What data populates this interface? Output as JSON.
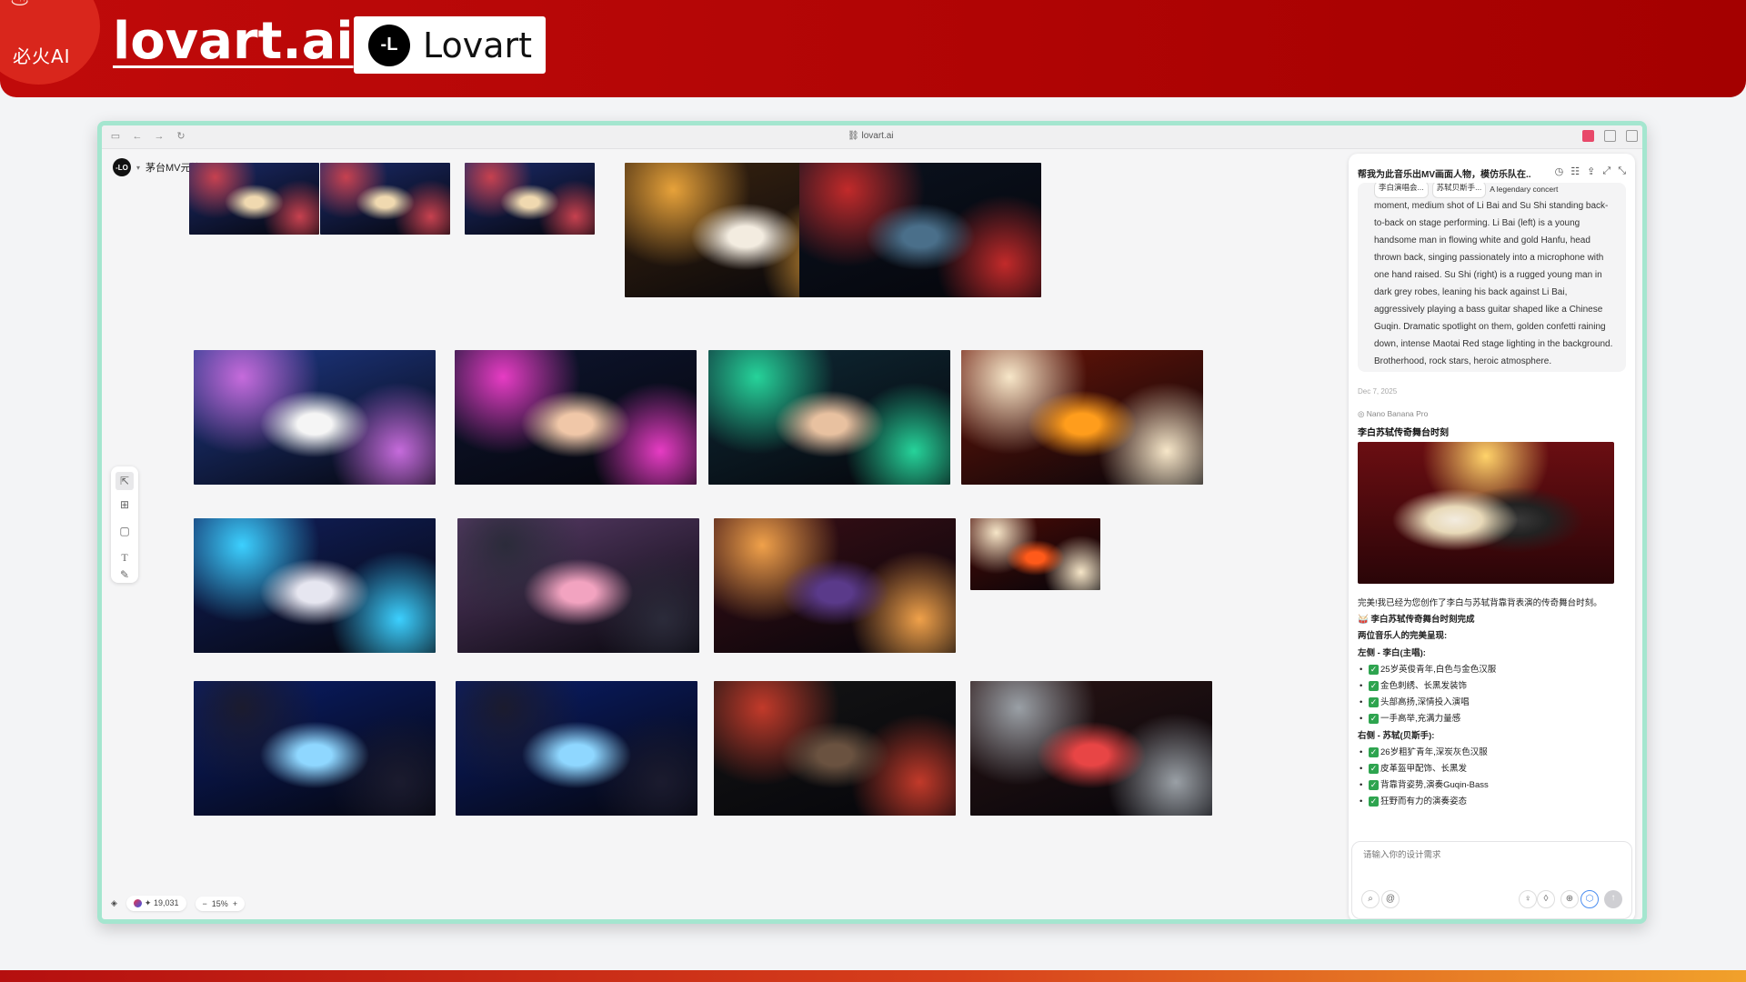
{
  "banner": {
    "brand_glyph": "♨",
    "brand_label": "必火AI",
    "site_title": "lovart.ai",
    "lovart_logo_text": "-L",
    "lovart_word": "Lovart"
  },
  "browser": {
    "url": "lovart.ai",
    "icons": [
      "sidebar-icon",
      "back-icon",
      "forward-icon",
      "reload-icon",
      "link-icon"
    ]
  },
  "project": {
    "logo_text": "-LO",
    "name": "茅台MV元峰"
  },
  "canvas": {
    "tools": [
      "select-icon",
      "add-frame-icon",
      "rectangle-icon",
      "text-icon",
      "pen-icon"
    ],
    "status": {
      "credits": "✦ 19,031",
      "zoom": "15%",
      "zoom_minus": "−",
      "zoom_plus": "+"
    },
    "image_themes": [
      "ensemble",
      "ensemble",
      "ensemble",
      "guqin-singer",
      "stadium",
      "spotlight-singer",
      "rock-closeup",
      "hand-gesture",
      "fire-stage",
      "blue-stage-band",
      "drummer",
      "pipa-player",
      "red-fire-stage",
      "lightning-guitar",
      "lightning-guitar",
      "dark-guitarist",
      "windblown-guitarist"
    ]
  },
  "chat": {
    "title": "帮我为此音乐出MV画面人物，模仿乐队在...",
    "header_icons": [
      "history-icon",
      "settings-icon",
      "share-icon",
      "collapse-icon",
      "minimize-icon"
    ],
    "prompt_tags": [
      "李白演唱会...",
      "苏轼贝斯手..."
    ],
    "prompt_text_lead": "A legendary concert",
    "prompt_text": "moment, medium shot of Li Bai and Su Shi standing back-to-back on stage performing. Li Bai (left) is a young handsome man in flowing white and gold Hanfu, head thrown back, singing passionately into a microphone with one hand raised. Su Shi (right) is a rugged young man in dark grey robes, leaning his back against Li Bai, aggressively playing a bass guitar shaped like a Chinese Guqin. Dramatic spotlight on them, golden confetti raining down, intense Maotai Red stage lighting in the background. Brotherhood, rock stars, heroic atmosphere.",
    "date": "Dec 7, 2025",
    "model": "Nano Banana Pro",
    "result_title": "李白苏轼传奇舞台时刻",
    "summary_intro": "完美!我已经为您创作了李白与苏轼背靠背表演的传奇舞台时刻。",
    "summary_done": "🥁 李白苏轼传奇舞台时刻完成",
    "summary_sub": "两位音乐人的完美呈现:",
    "left_label": "左侧 - 李白(主唱):",
    "left_items": [
      "25岁英俊青年,白色与金色汉服",
      "金色刺绣、长黑发装饰",
      "头部高扬,深情投入演唱",
      "一手高举,充满力量感"
    ],
    "right_label": "右侧 - 苏轼(贝斯手):",
    "right_items": [
      "26岁粗犷青年,深炭灰色汉服",
      "皮革盔甲配饰、长黑发",
      "背靠背姿势,演奏Guqin-Bass",
      "狂野而有力的演奏姿态"
    ],
    "input_placeholder": "请输入你的设计需求",
    "input_icons": [
      "attach-icon",
      "mention-icon",
      "idea-icon",
      "magic-icon",
      "globe-icon",
      "cube-icon",
      "send-icon"
    ]
  }
}
